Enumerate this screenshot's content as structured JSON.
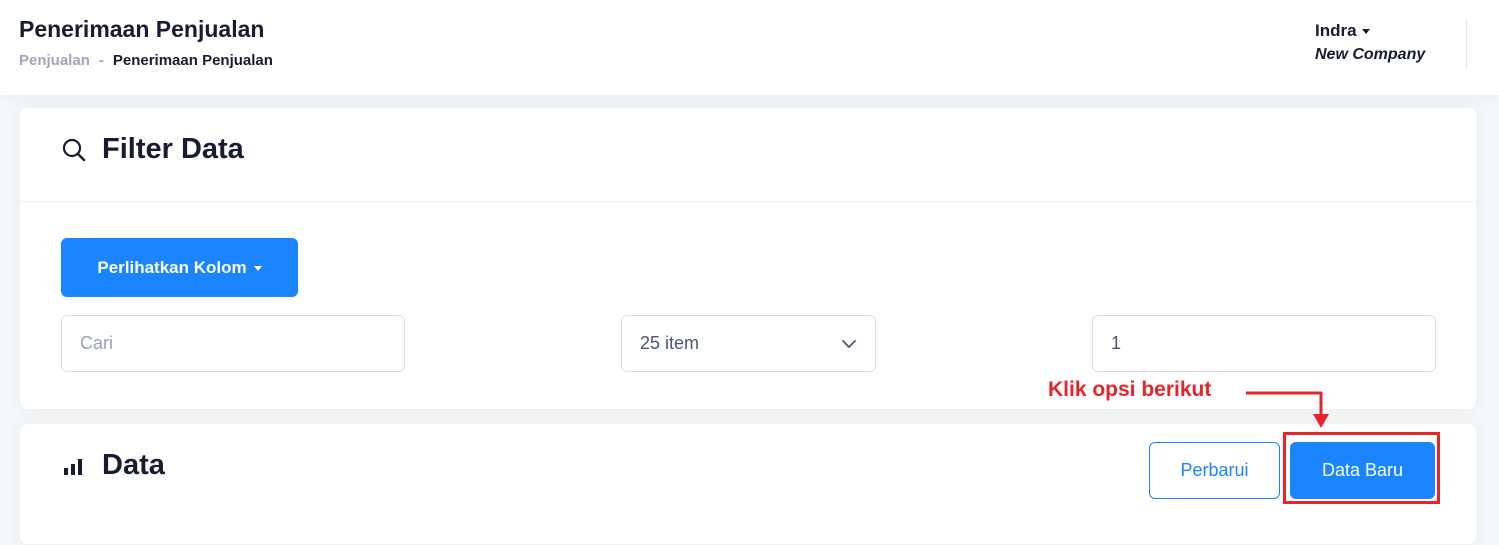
{
  "header": {
    "title": "Penerimaan Penjualan",
    "breadcrumb": {
      "parent": "Penjualan",
      "separator": "-",
      "current": "Penerimaan Penjualan"
    },
    "user": {
      "name": "Indra",
      "company": "New Company"
    }
  },
  "filter_card": {
    "title": "Filter Data",
    "icon": "search-icon",
    "columns_button_label": "Perlihatkan Kolom",
    "search": {
      "placeholder": "Cari",
      "value": ""
    },
    "page_size": {
      "selected": "25 item"
    },
    "page_number": {
      "value": "1"
    }
  },
  "data_card": {
    "title": "Data",
    "icon": "bar-chart-icon",
    "refresh_label": "Perbarui",
    "new_label": "Data Baru"
  },
  "annotation": {
    "text": "Klik opsi berikut",
    "color": "#e5252a"
  },
  "colors": {
    "primary": "#1b84ff",
    "text": "#181c32",
    "muted": "#a1a5b7",
    "background": "#f5f8fa"
  }
}
